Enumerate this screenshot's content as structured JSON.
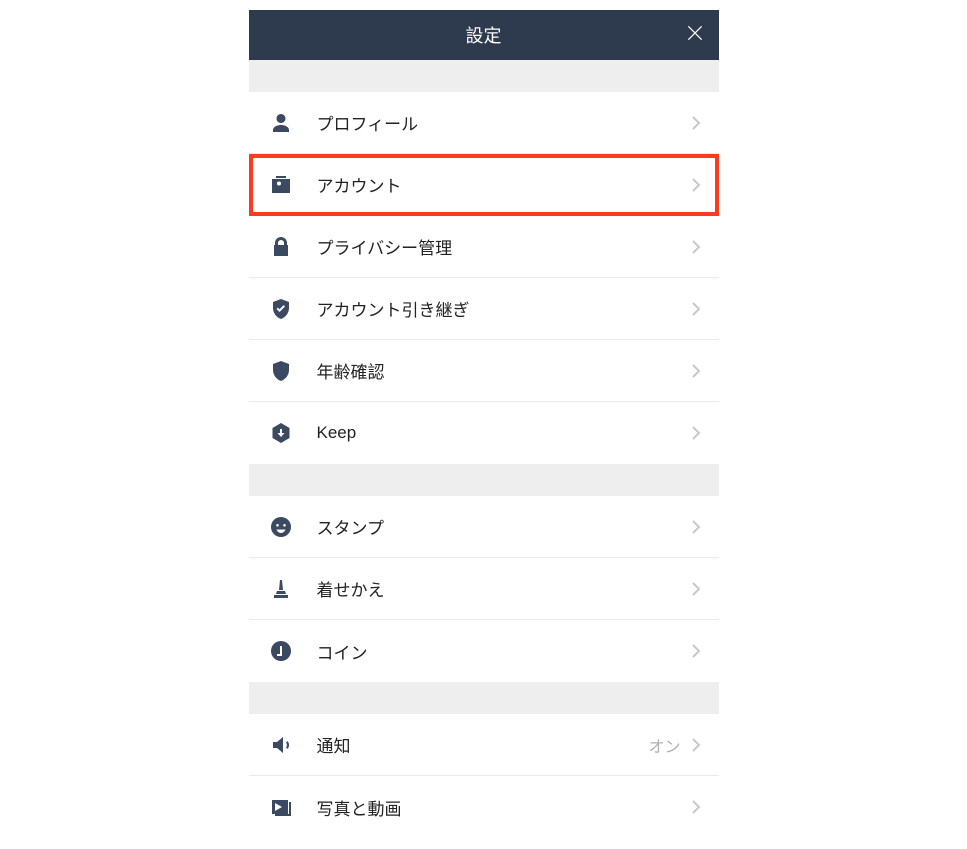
{
  "header": {
    "title": "設定"
  },
  "sections": [
    {
      "items": [
        {
          "icon": "person-icon",
          "label": "プロフィール",
          "value": "",
          "highlighted": false
        },
        {
          "icon": "id-card-icon",
          "label": "アカウント",
          "value": "",
          "highlighted": true
        },
        {
          "icon": "lock-icon",
          "label": "プライバシー管理",
          "value": "",
          "highlighted": false
        },
        {
          "icon": "shield-check-icon",
          "label": "アカウント引き継ぎ",
          "value": "",
          "highlighted": false
        },
        {
          "icon": "badge-person-icon",
          "label": "年齢確認",
          "value": "",
          "highlighted": false
        },
        {
          "icon": "download-hex-icon",
          "label": "Keep",
          "value": "",
          "highlighted": false
        }
      ]
    },
    {
      "items": [
        {
          "icon": "smile-icon",
          "label": "スタンプ",
          "value": "",
          "highlighted": false
        },
        {
          "icon": "brush-icon",
          "label": "着せかえ",
          "value": "",
          "highlighted": false
        },
        {
          "icon": "coin-icon",
          "label": "コイン",
          "value": "",
          "highlighted": false
        }
      ]
    },
    {
      "items": [
        {
          "icon": "speaker-icon",
          "label": "通知",
          "value": "オン",
          "highlighted": false
        },
        {
          "icon": "media-icon",
          "label": "写真と動画",
          "value": "",
          "highlighted": false
        }
      ]
    }
  ]
}
